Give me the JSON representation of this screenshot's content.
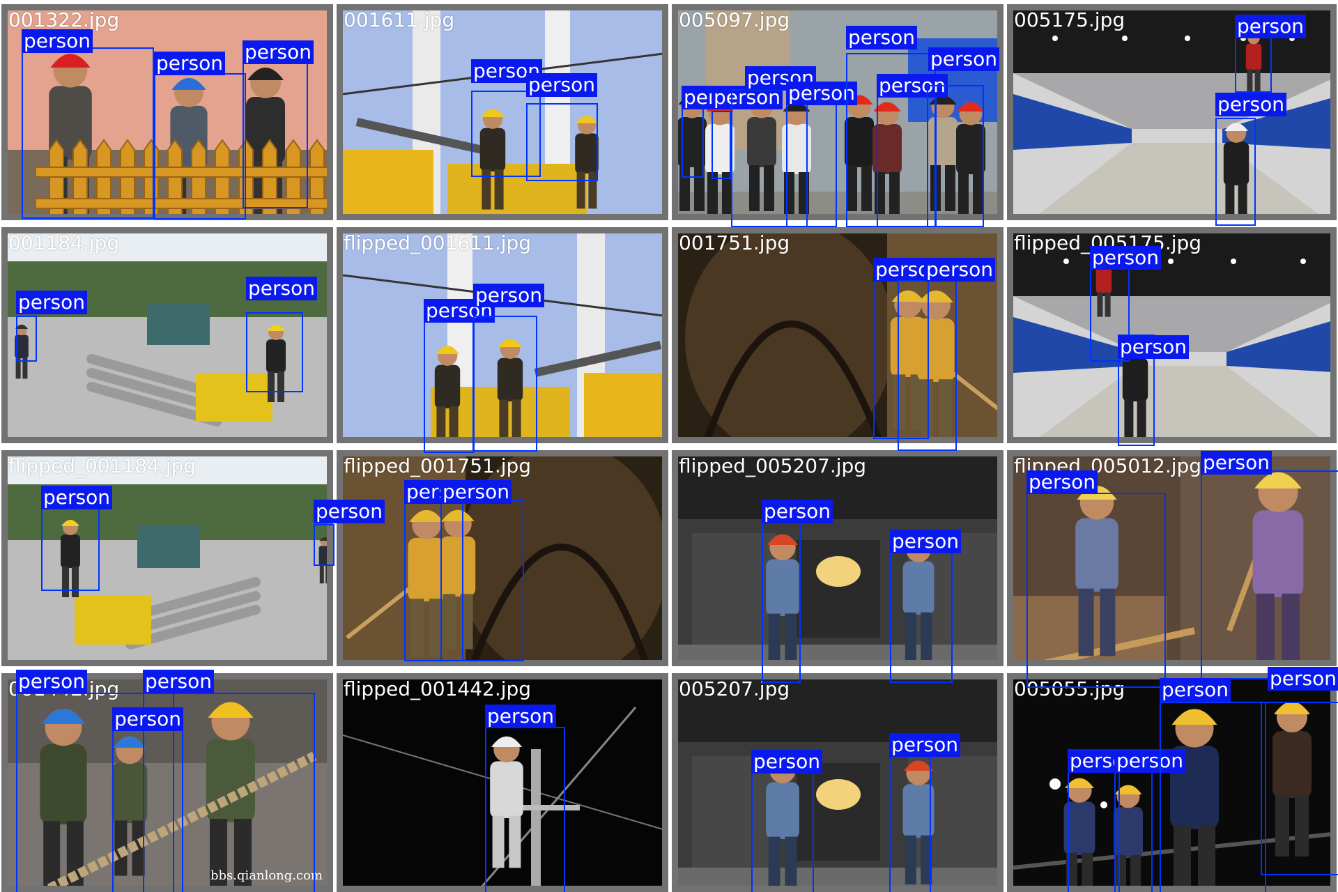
{
  "colors": {
    "box": "#0033ff",
    "label_bg": "#0a19ee",
    "label_text": "#ffffff",
    "tile_border": "#727272"
  },
  "tiles": [
    {
      "filename": "001322.jpg",
      "scene": "orange-wall",
      "detections": [
        {
          "label": "person"
        },
        {
          "label": "person"
        },
        {
          "label": "person"
        }
      ]
    },
    {
      "filename": "001611.jpg",
      "scene": "sky-pole",
      "detections": [
        {
          "label": "person"
        },
        {
          "label": "person"
        }
      ]
    },
    {
      "filename": "005097.jpg",
      "scene": "crowd-construction",
      "detections": [
        {
          "label": "person"
        },
        {
          "label": "person"
        },
        {
          "label": "person"
        },
        {
          "label": "person"
        },
        {
          "label": "person"
        },
        {
          "label": "person"
        },
        {
          "label": "person"
        }
      ]
    },
    {
      "filename": "005175.jpg",
      "scene": "tunnel",
      "detections": [
        {
          "label": "person"
        },
        {
          "label": "person"
        }
      ]
    },
    {
      "filename": "001184.jpg",
      "scene": "paving",
      "detections": [
        {
          "label": "person"
        },
        {
          "label": "person"
        }
      ]
    },
    {
      "filename": "flipped_001611.jpg",
      "scene": "sky-pole-flipped",
      "detections": [
        {
          "label": "person"
        },
        {
          "label": "person"
        }
      ]
    },
    {
      "filename": "001751.jpg",
      "scene": "mine",
      "detections": [
        {
          "label": "person"
        },
        {
          "label": "person"
        }
      ]
    },
    {
      "filename": "flipped_005175.jpg",
      "scene": "tunnel-flipped",
      "detections": [
        {
          "label": "person"
        },
        {
          "label": "person"
        }
      ]
    },
    {
      "filename": "flipped_001184.jpg",
      "scene": "paving-flipped",
      "detections": [
        {
          "label": "person"
        },
        {
          "label": "person"
        }
      ]
    },
    {
      "filename": "flipped_001751.jpg",
      "scene": "mine-flipped",
      "detections": [
        {
          "label": "person"
        },
        {
          "label": "person"
        }
      ]
    },
    {
      "filename": "flipped_005207.jpg",
      "scene": "furnace",
      "detections": [
        {
          "label": "person"
        },
        {
          "label": "person"
        }
      ]
    },
    {
      "filename": "flipped_005012.jpg",
      "scene": "drilling",
      "detections": [
        {
          "label": "person"
        },
        {
          "label": "person"
        }
      ]
    },
    {
      "filename": "001442.jpg",
      "scene": "rope-pull",
      "watermark": "bbs.qianlong.com",
      "detections": [
        {
          "label": "person"
        },
        {
          "label": "person"
        },
        {
          "label": "person"
        }
      ]
    },
    {
      "filename": "flipped_001442.jpg",
      "scene": "night-pole",
      "detections": [
        {
          "label": "person"
        }
      ]
    },
    {
      "filename": "005207.jpg",
      "scene": "furnace",
      "detections": [
        {
          "label": "person"
        },
        {
          "label": "person"
        }
      ]
    },
    {
      "filename": "005055.jpg",
      "scene": "night-rail",
      "detections": [
        {
          "label": "person"
        },
        {
          "label": "person"
        },
        {
          "label": "person"
        },
        {
          "label": "person"
        }
      ]
    }
  ]
}
